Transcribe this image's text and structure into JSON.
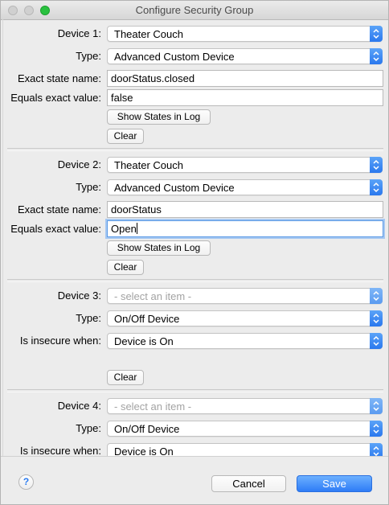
{
  "window": {
    "title": "Configure Security Group"
  },
  "groups": [
    {
      "device_label": "Device 1:",
      "device_value": "Theater Couch",
      "type_label": "Type:",
      "type_value": "Advanced Custom Device",
      "state_label": "Exact state name:",
      "state_value": "doorStatus.closed",
      "equals_label": "Equals exact value:",
      "equals_value": "false",
      "show_states_label": "Show States in Log",
      "clear_label": "Clear"
    },
    {
      "device_label": "Device 2:",
      "device_value": "Theater Couch",
      "type_label": "Type:",
      "type_value": "Advanced Custom Device",
      "state_label": "Exact state name:",
      "state_value": "doorStatus",
      "equals_label": "Equals exact value:",
      "equals_value": "Open",
      "show_states_label": "Show States in Log",
      "clear_label": "Clear"
    },
    {
      "device_label": "Device 3:",
      "device_placeholder": "- select an item -",
      "type_label": "Type:",
      "type_value": "On/Off Device",
      "insecure_label": "Is insecure when:",
      "insecure_value": "Device is On",
      "clear_label": "Clear"
    },
    {
      "device_label": "Device 4:",
      "device_placeholder": "- select an item -",
      "type_label": "Type:",
      "type_value": "On/Off Device",
      "insecure_label": "Is insecure when:",
      "insecure_value": "Device is On"
    }
  ],
  "footer": {
    "help_label": "?",
    "cancel_label": "Cancel",
    "save_label": "Save"
  },
  "colors": {
    "accent": "#2e7cf6",
    "focus_ring": "#a6c8f2",
    "zoom_button": "#29c13f"
  },
  "icons": {
    "popup_arrows": "up-down-chevron-icon",
    "help": "help-icon"
  }
}
